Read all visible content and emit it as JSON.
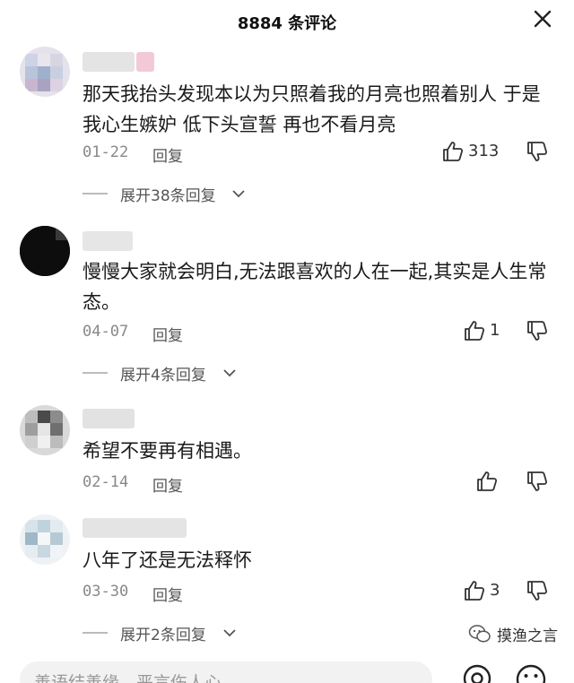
{
  "header": {
    "title": "8884 条评论"
  },
  "comments": [
    {
      "text": "那天我抬头发现本以为只照着我的月亮也照着别人 于是我心生嫉妒 低下头宣誓 再也不看月亮",
      "date": "01-22",
      "reply_label": "回复",
      "likes": "313",
      "expand_label": "展开38条回复"
    },
    {
      "text": "慢慢大家就会明白,无法跟喜欢的人在一起,其实是人生常态。",
      "date": "04-07",
      "reply_label": "回复",
      "likes": "1",
      "expand_label": "展开4条回复"
    },
    {
      "text": "希望不要再有相遇。",
      "date": "02-14",
      "reply_label": "回复",
      "likes": "",
      "expand_label": ""
    },
    {
      "text": "八年了还是无法释怀",
      "date": "03-30",
      "reply_label": "回复",
      "likes": "3",
      "expand_label": "展开2条回复"
    }
  ],
  "input": {
    "placeholder": "善语结善缘，恶言伤人心"
  },
  "watermark": {
    "text": "摸渔之言"
  },
  "colors": {
    "text": "#1a1a1a",
    "muted": "#888888",
    "divider": "#bbbbbb",
    "input_bg": "#f2f2f2"
  },
  "icons": [
    "close-icon",
    "thumbs-up-icon",
    "thumbs-down-icon",
    "chevron-down-icon",
    "at-icon",
    "emoji-icon",
    "wechat-icon"
  ]
}
